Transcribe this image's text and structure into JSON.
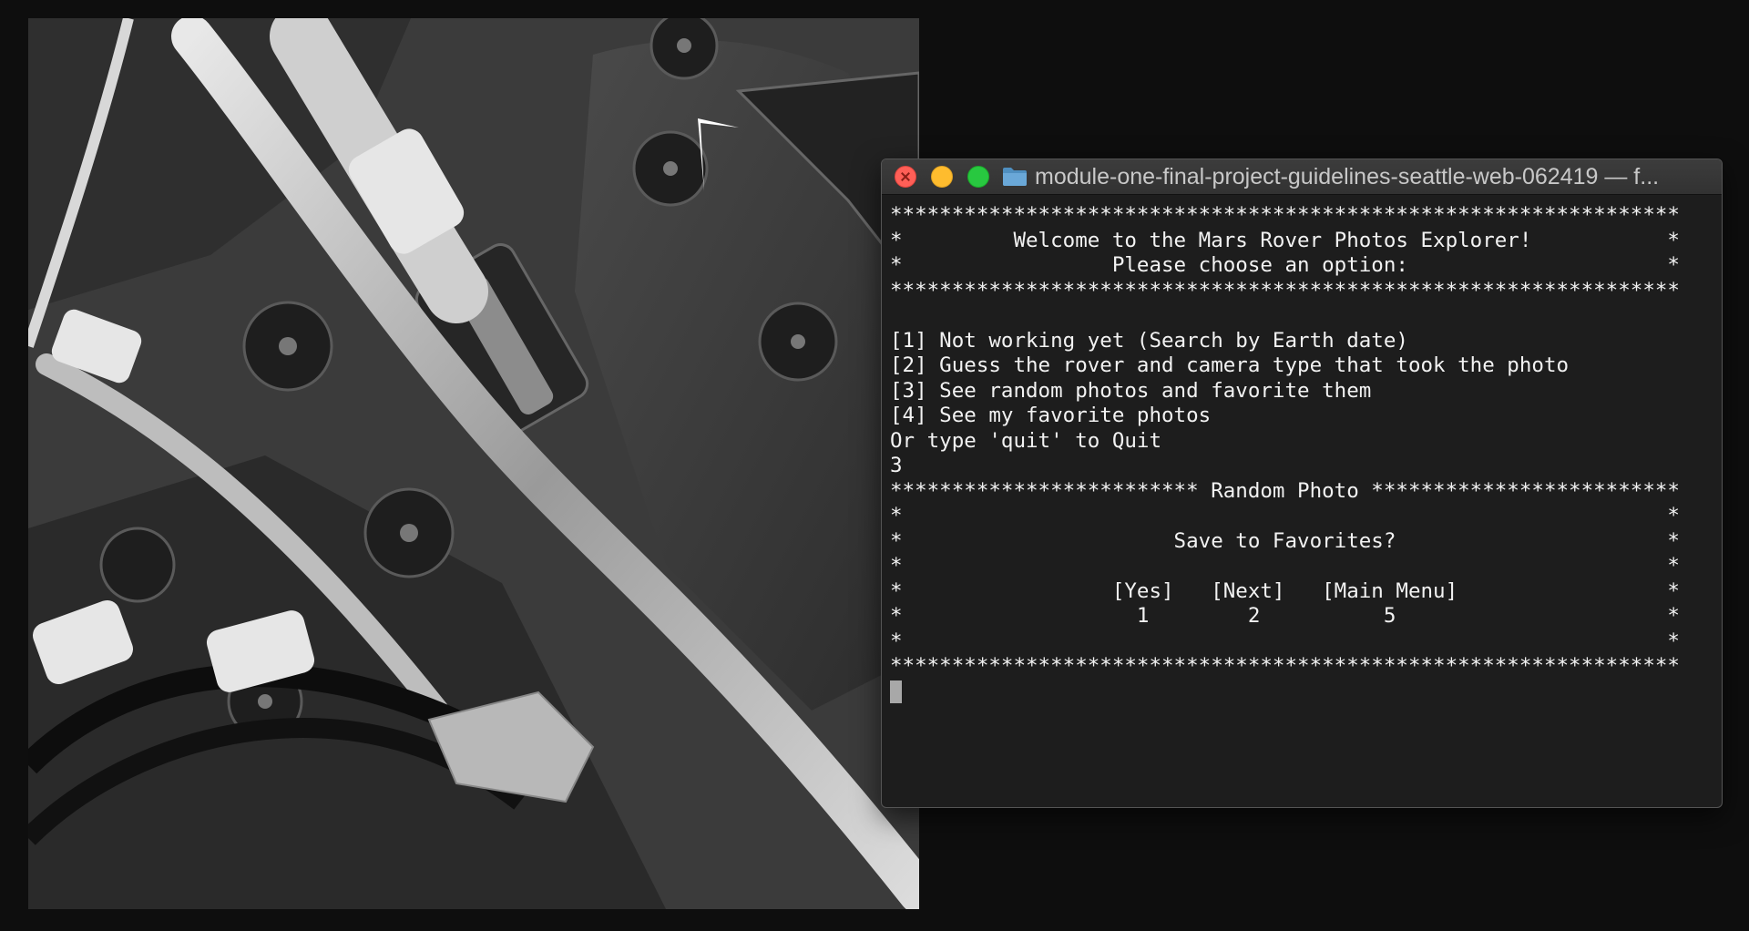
{
  "photo": {
    "description_icon": "mars-rover-photo"
  },
  "terminal": {
    "title": "module-one-final-project-guidelines-seattle-web-062419 — f...",
    "lines": [
      "****************************************************************",
      "*         Welcome to the Mars Rover Photos Explorer!           *",
      "*                 Please choose an option:                     *",
      "****************************************************************",
      "",
      "[1] Not working yet (Search by Earth date)",
      "[2] Guess the rover and camera type that took the photo",
      "[3] See random photos and favorite them",
      "[4] See my favorite photos",
      "Or type 'quit' to Quit",
      "3",
      "************************* Random Photo *************************",
      "*                                                              *",
      "*                      Save to Favorites?                      *",
      "*                                                              *",
      "*                 [Yes]   [Next]   [Main Menu]                 *",
      "*                   1        2          5                      *",
      "*                                                              *",
      "****************************************************************"
    ],
    "colors": {
      "close": "#fe5f57",
      "minimize": "#febc2e",
      "maximize": "#28c840",
      "folder": "#5a9fd4"
    }
  }
}
